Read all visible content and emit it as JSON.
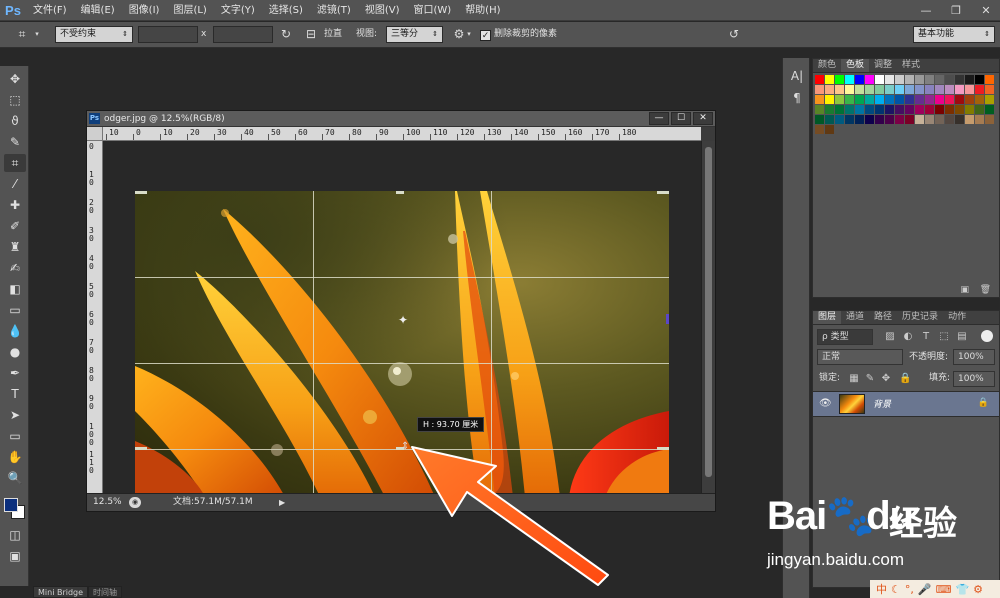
{
  "app": {
    "logo": "Ps"
  },
  "menu": [
    "文件(F)",
    "编辑(E)",
    "图像(I)",
    "图层(L)",
    "文字(Y)",
    "选择(S)",
    "滤镜(T)",
    "视图(V)",
    "窗口(W)",
    "帮助(H)"
  ],
  "window_controls": {
    "minimize": "—",
    "restore": "❐",
    "close": "✕"
  },
  "options": {
    "ratio": "不受约束",
    "x_sep": "x",
    "straighten": "拉直",
    "view_label": "视图:",
    "view_value": "三等分",
    "delete_cropped": "删除裁剪的像素",
    "workspace": "基本功能"
  },
  "document": {
    "title": "odger.jpg @ 12.5%(RGB/8)",
    "ruler_h": [
      "10",
      "0",
      "10",
      "20",
      "30",
      "40",
      "50",
      "60",
      "70",
      "80",
      "90",
      "100",
      "110",
      "120",
      "130",
      "140",
      "150",
      "160",
      "170",
      "180"
    ],
    "ruler_v": [
      "0",
      "1 0",
      "2 0",
      "3 0",
      "4 0",
      "5 0",
      "6 0",
      "7 0",
      "8 0",
      "9 0",
      "1 0 0",
      "1 1 0"
    ],
    "zoom": "12.5%",
    "doc_info": "文档:57.1M/57.1M",
    "tooltip": "H : 93.70 厘米"
  },
  "swatches_panel": {
    "tabs": [
      "颜色",
      "色板",
      "调整",
      "样式"
    ],
    "active": 1
  },
  "swatch_colors": [
    "#ff0000",
    "#ffff00",
    "#00ff00",
    "#00ffff",
    "#0000ff",
    "#ff00ff",
    "#ffffff",
    "#e6e6e6",
    "#cccccc",
    "#b3b3b3",
    "#999999",
    "#808080",
    "#666666",
    "#4d4d4d",
    "#333333",
    "#1a1a1a",
    "#000000",
    "#ff6600",
    "#f7977a",
    "#f9ad81",
    "#fdc68a",
    "#fff79a",
    "#c4df9b",
    "#a2d39c",
    "#82ca9d",
    "#7bcdc8",
    "#6ecff6",
    "#7ea7d8",
    "#8493ca",
    "#8882be",
    "#a187be",
    "#bc8dbf",
    "#f49ac2",
    "#f6989d",
    "#ed1c24",
    "#f26522",
    "#f7941d",
    "#fff200",
    "#8dc73f",
    "#39b54a",
    "#00a651",
    "#00a99d",
    "#00aeef",
    "#0072bc",
    "#0054a6",
    "#2e3192",
    "#662d91",
    "#92278f",
    "#ec008c",
    "#ed145b",
    "#9e0b0f",
    "#a0410d",
    "#a3620a",
    "#aba000",
    "#598527",
    "#1a7b30",
    "#007236",
    "#00746b",
    "#0076a3",
    "#004a80",
    "#003471",
    "#1b1464",
    "#440e62",
    "#630460",
    "#9e005d",
    "#9e0039",
    "#790000",
    "#7b2e00",
    "#7d4900",
    "#827b00",
    "#406618",
    "#005e20",
    "#005826",
    "#005952",
    "#005b7f",
    "#003663",
    "#002157",
    "#0d004c",
    "#32004b",
    "#4b0049",
    "#7b0046",
    "#7a0026",
    "#c7b299",
    "#998675",
    "#736357",
    "#534741",
    "#37302b",
    "#c69c6d",
    "#a67c52",
    "#8c6239",
    "#754c24",
    "#603913"
  ],
  "layers_panel": {
    "tabs": [
      "图层",
      "通道",
      "路径",
      "历史记录",
      "动作"
    ],
    "active": 0,
    "filter": "ρ 类型",
    "blend_mode": "正常",
    "opacity_label": "不透明度:",
    "opacity": "100%",
    "lock_label": "锁定:",
    "fill_label": "填充:",
    "fill": "100%",
    "layer_name": "背景"
  },
  "bottom_tabs": [
    "Mini Bridge",
    "时间轴"
  ],
  "watermark": {
    "brand": "Bai",
    "brand2": "du",
    "cn": "经验",
    "url": "jingyan.baidu.com"
  }
}
